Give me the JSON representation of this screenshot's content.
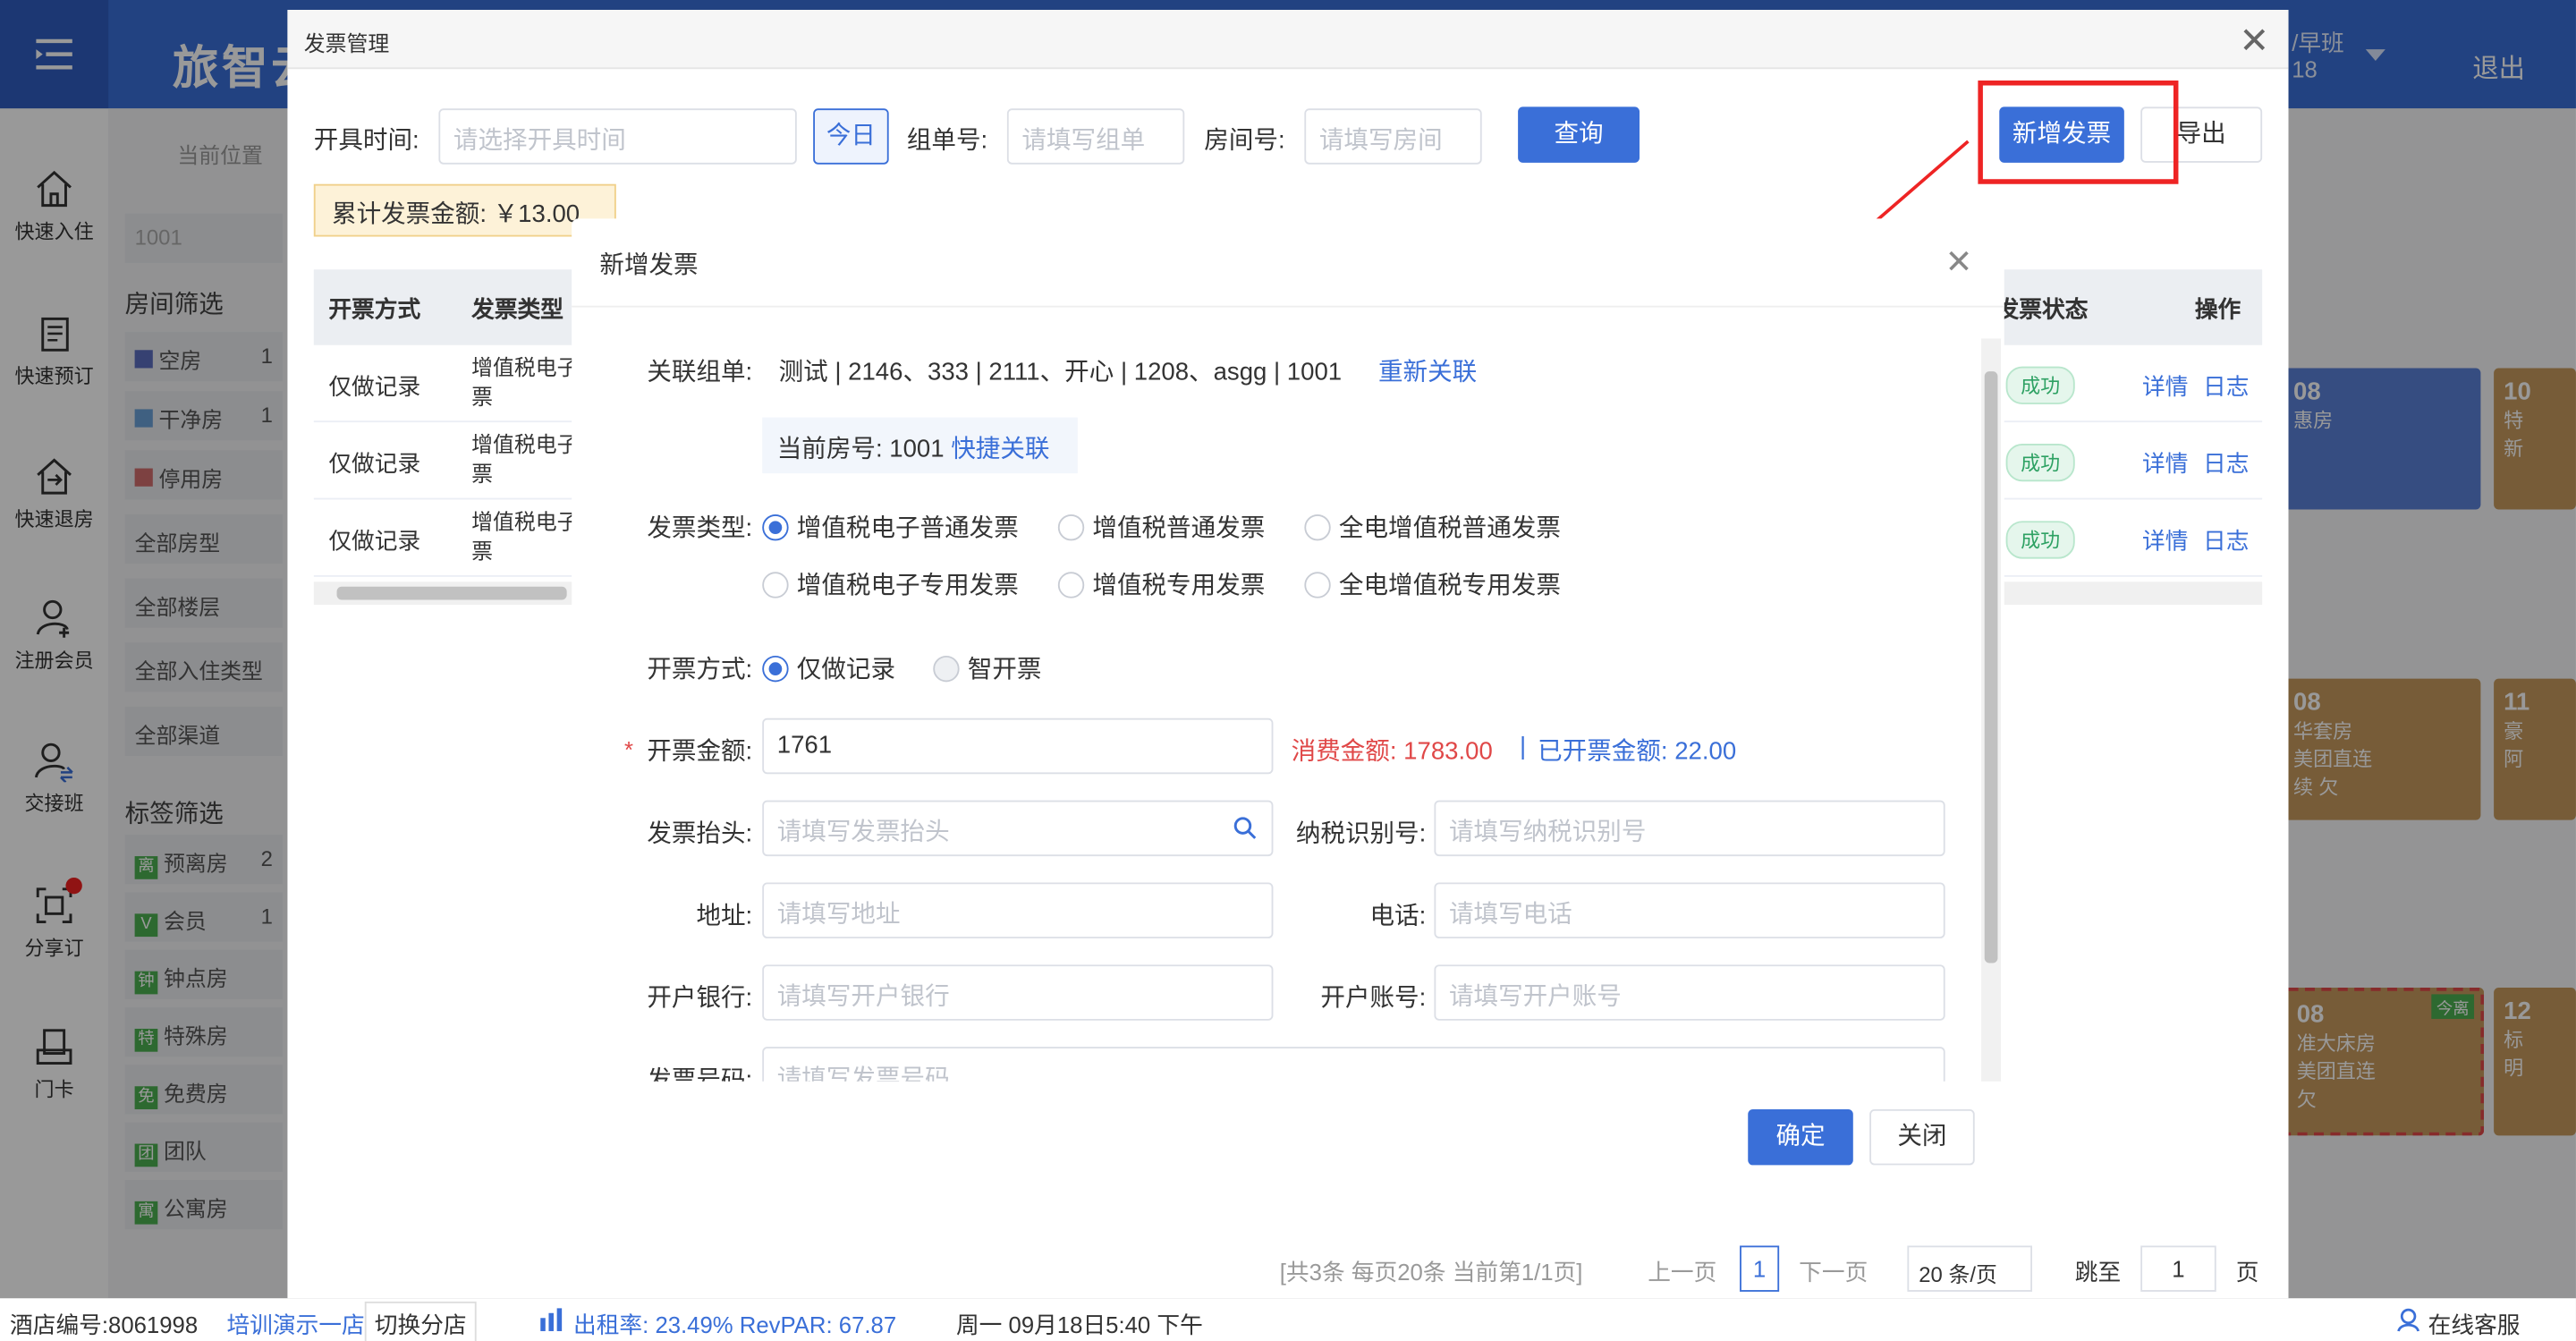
{
  "app": {
    "brand": "旅智云",
    "shift": "/早班",
    "shift_sub": "18",
    "logout": "退出"
  },
  "sidebar": [
    "快速入住",
    "快速预订",
    "快速退房",
    "注册会员",
    "交接班",
    "分享订",
    "门卡"
  ],
  "filters": {
    "breadcrumb": "当前位置",
    "search": "1001",
    "room_title": "房间筛选",
    "room_states": [
      {
        "label": "空房",
        "count": "1",
        "color": "#5b6dbf"
      },
      {
        "label": "干净房",
        "count": "1",
        "color": "#6aa1d8"
      },
      {
        "label": "停用房",
        "count": "",
        "color": "#d06d6d"
      }
    ],
    "selects": [
      "全部房型",
      "全部楼层",
      "全部入住类型",
      "全部渠道"
    ],
    "tag_title": "标签筛选",
    "tags": [
      {
        "t": "离",
        "label": "预离房",
        "count": "2",
        "color": "#4caf50"
      },
      {
        "t": "V",
        "label": "会员",
        "count": "1",
        "color": "#4caf50"
      },
      {
        "t": "钟",
        "label": "钟点房",
        "count": "",
        "color": "#4caf50"
      },
      {
        "t": "特",
        "label": "特殊房",
        "count": "",
        "color": "#4caf50"
      },
      {
        "t": "免",
        "label": "免费房",
        "count": "",
        "color": "#4caf50"
      },
      {
        "t": "团",
        "label": "团队",
        "count": "",
        "color": "#4caf50"
      },
      {
        "t": "寓",
        "label": "公寓房",
        "count": "",
        "color": "#4caf50"
      }
    ]
  },
  "rooms": [
    {
      "no": "08",
      "type": "惠房"
    },
    {
      "no": "10",
      "type": "特"
    },
    {
      "no": "08",
      "type": "华套房"
    },
    {
      "no": "11",
      "type": "豪"
    },
    {
      "no": "08",
      "type": "准大床房"
    },
    {
      "no": "12",
      "type": "标"
    }
  ],
  "room_tags": {
    "meituan": "美团直连",
    "xu": "续",
    "qian": "欠",
    "jinli": "今离",
    "xin": "新",
    "ye": "阿",
    "ming": "明"
  },
  "outer": {
    "title": "发票管理",
    "filter": {
      "time_label": "开具时间:",
      "time_ph": "请选择开具时间",
      "today": "今日",
      "group_label": "组单号:",
      "group_ph": "请填写组单",
      "room_label": "房间号:",
      "room_ph": "请填写房间",
      "query": "查询",
      "add": "新增发票",
      "export": "导出"
    },
    "total": "累计发票金额: ￥13.00",
    "headers": [
      "开票方式",
      "发票类型",
      "发票状态",
      "操作"
    ],
    "rows": [
      {
        "mode": "仅做记录",
        "type": "增值税电子",
        "type2": "票",
        "status": "成功",
        "a1": "详情",
        "a2": "日志"
      },
      {
        "mode": "仅做记录",
        "type": "增值税电子",
        "type2": "票",
        "status": "成功",
        "a1": "详情",
        "a2": "日志"
      },
      {
        "mode": "仅做记录",
        "type": "增值税电子",
        "type2": "票",
        "status": "成功",
        "a1": "详情",
        "a2": "日志"
      }
    ],
    "pager": {
      "info": "[共3条 每页20条 当前第1/1页]",
      "prev": "上一页",
      "page": "1",
      "next": "下一页",
      "size": "20 条/页",
      "jump": "跳至",
      "jump_val": "1",
      "page_unit": "页"
    }
  },
  "inner": {
    "title": "新增发票",
    "link_label": "关联组单:",
    "link_value": "测试 | 2146、333 | 2111、开心 | 1208、asgg | 1001",
    "relink": "重新关联",
    "room_label": "当前房号: 1001",
    "quick_link": "快捷关联",
    "type_label": "发票类型:",
    "types": [
      "增值税电子普通发票",
      "增值税普通发票",
      "全电增值税普通发票",
      "增值税电子专用发票",
      "增值税专用发票",
      "全电增值税专用发票"
    ],
    "mode_label": "开票方式:",
    "modes": [
      "仅做记录",
      "智开票"
    ],
    "amount_label": "开票金额:",
    "amount_value": "1761",
    "consume_label": "消费金额:",
    "consume_value": "1783.00",
    "sep": "|",
    "issued_label": "已开票金额:",
    "issued_value": "22.00",
    "head_label": "发票抬头:",
    "head_ph": "请填写发票抬头",
    "tax_label": "纳税识别号:",
    "tax_ph": "请填写纳税识别号",
    "addr_label": "地址:",
    "addr_ph": "请填写地址",
    "tel_label": "电话:",
    "tel_ph": "请填写电话",
    "bank_label": "开户银行:",
    "bank_ph": "请填写开户银行",
    "acct_label": "开户账号:",
    "acct_ph": "请填写开户账号",
    "no_label": "发票号码:",
    "no_ph": "请填写发票号码",
    "ok": "确定",
    "close": "关闭"
  },
  "footer": {
    "hotel": "酒店编号:8061998",
    "hotel_name": "培训演示一店",
    "switch": "切换分店",
    "occ": "出租率: 23.49% RevPAR: 67.87",
    "date": "周一 09月18日5:40 下午",
    "service": "在线客服"
  }
}
